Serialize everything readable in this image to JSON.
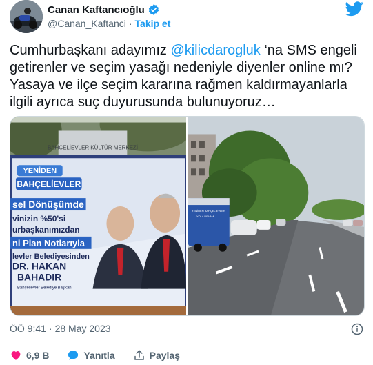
{
  "author": {
    "name": "Canan Kaftancıoğlu",
    "handle": "@Canan_Kaftanci",
    "separator": "·",
    "follow_label": "Takip et"
  },
  "tweet": {
    "text_before": "Cumhurbaşkanı adayımız ",
    "mention": "@kilicdarogluk",
    "text_after": " ‘na SMS engeli getirenler ve seçim yasağı nedeniyle diyenler online mı? Yasaya ve ilçe seçim kararına rağmen kaldırmayanlarla ilgili ayrıca suç duyurusunda bulunuyoruz…"
  },
  "billboard": {
    "building": "BAHÇELİEVLER KÜLTÜR MERKEZİ",
    "tag1": "YENİDEN",
    "tag2": "BAHÇELİEVLER",
    "line1": "sel Dönüşümde",
    "line2": "vinizin %50'si",
    "line3": "urbaşkanımızdan",
    "line4": "ni Plan Notlarıyla",
    "line5": "levler Belediyesinden",
    "person_name": "DR. HAKAN",
    "person_surname": "BAHADIR",
    "person_title": "Bahçelievler Belediye Başkanı"
  },
  "street_photo": {
    "van_text_1": "YENİDEN BAHÇELİEVLER",
    "van_text_2": "YOLA DEVAM"
  },
  "meta": {
    "time": "ÖÖ 9:41",
    "separator": "·",
    "date": "28 May 2023"
  },
  "actions": {
    "like_count": "6,9 B",
    "reply_label": "Yanıtla",
    "share_label": "Paylaş"
  },
  "colors": {
    "accent": "#1d9bf0",
    "like": "#f91880",
    "text": "#0f1419",
    "secondary": "#536471"
  }
}
